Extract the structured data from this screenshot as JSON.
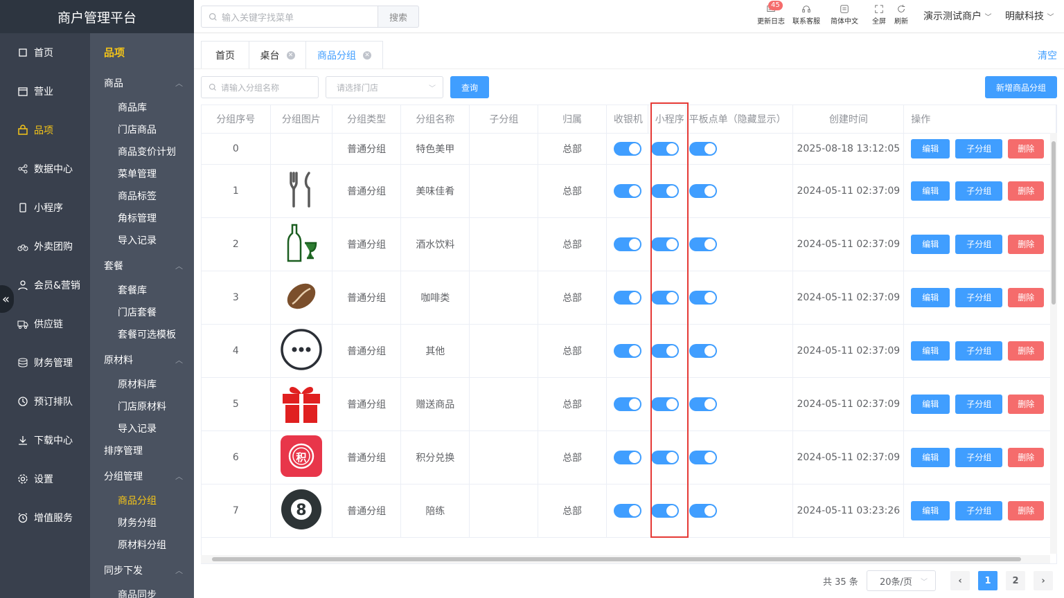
{
  "brand": "商户管理平台",
  "nav": [
    {
      "label": "首页",
      "icon": "home-icon"
    },
    {
      "label": "营业",
      "icon": "calendar-icon"
    },
    {
      "label": "品项",
      "icon": "bag-icon",
      "active": true
    },
    {
      "label": "数据中心",
      "icon": "share-icon"
    },
    {
      "label": "小程序",
      "icon": "phone-icon"
    },
    {
      "label": "外卖团购",
      "icon": "bike-icon"
    },
    {
      "label": "会员&营销",
      "icon": "user-icon"
    },
    {
      "label": "供应链",
      "icon": "truck-icon"
    },
    {
      "label": "财务管理",
      "icon": "database-icon"
    },
    {
      "label": "预订排队",
      "icon": "clock-icon"
    },
    {
      "label": "下载中心",
      "icon": "download-icon"
    },
    {
      "label": "设置",
      "icon": "gear-icon"
    },
    {
      "label": "增值服务",
      "icon": "alarm-icon"
    }
  ],
  "subnav": {
    "title": "品项",
    "groups": [
      {
        "label": "商品",
        "items": [
          "商品库",
          "门店商品",
          "商品变价计划",
          "菜单管理",
          "商品标签",
          "角标管理",
          "导入记录"
        ]
      },
      {
        "label": "套餐",
        "items": [
          "套餐库",
          "门店套餐",
          "套餐可选模板"
        ]
      },
      {
        "label": "原材料",
        "items": [
          "原材料库",
          "门店原材料",
          "导入记录"
        ]
      },
      {
        "label": "排序管理",
        "items": []
      },
      {
        "label": "分组管理",
        "items": [
          "商品分组",
          "财务分组",
          "原材料分组"
        ]
      },
      {
        "label": "同步下发",
        "items": [
          "商品同步"
        ]
      }
    ],
    "active_item": "商品分组"
  },
  "topbar": {
    "search_placeholder": "输入关键字找菜单",
    "search_btn": "搜索",
    "tools": [
      {
        "label": "更新日志",
        "icon": "message-icon",
        "badge": "45"
      },
      {
        "label": "联系客服",
        "icon": "headset-icon"
      },
      {
        "label": "简体中文",
        "icon": "translate-icon"
      },
      {
        "label": "全屏",
        "icon": "fullscreen-icon"
      },
      {
        "label": "刷新",
        "icon": "refresh-icon"
      }
    ],
    "merchant": "演示测试商户",
    "company": "明献科技"
  },
  "tabs": [
    {
      "label": "首页",
      "closable": false,
      "active": false
    },
    {
      "label": "桌台",
      "closable": true,
      "active": false
    },
    {
      "label": "商品分组",
      "closable": true,
      "active": true
    }
  ],
  "clear_label": "清空",
  "filters": {
    "name_placeholder": "请输入分组名称",
    "store_placeholder": "请选择门店",
    "query_btn": "查询",
    "add_btn": "新增商品分组"
  },
  "table": {
    "columns": [
      "分组序号",
      "分组图片",
      "分组类型",
      "分组名称",
      "子分组",
      "归属",
      "收银机",
      "小程序",
      "平板点单（隐藏显示）",
      "创建时间",
      "操作"
    ],
    "actions": {
      "edit": "编辑",
      "sub": "子分组",
      "del": "删除"
    },
    "rows": [
      {
        "seq": "0",
        "image": "",
        "type": "普通分组",
        "name": "特色美甲",
        "sub": "",
        "owner": "总部",
        "pos": true,
        "mini": true,
        "tablet": true,
        "created": "2025-08-18 13:12:05"
      },
      {
        "seq": "1",
        "image": "cutlery-icon",
        "type": "普通分组",
        "name": "美味佳肴",
        "sub": "",
        "owner": "总部",
        "pos": true,
        "mini": true,
        "tablet": true,
        "created": "2024-05-11 02:37:09"
      },
      {
        "seq": "2",
        "image": "wine-icon",
        "type": "普通分组",
        "name": "酒水饮料",
        "sub": "",
        "owner": "总部",
        "pos": true,
        "mini": true,
        "tablet": true,
        "created": "2024-05-11 02:37:09"
      },
      {
        "seq": "3",
        "image": "coffee-bean-icon",
        "type": "普通分组",
        "name": "咖啡类",
        "sub": "",
        "owner": "总部",
        "pos": true,
        "mini": true,
        "tablet": true,
        "created": "2024-05-11 02:37:09"
      },
      {
        "seq": "4",
        "image": "more-icon",
        "type": "普通分组",
        "name": "其他",
        "sub": "",
        "owner": "总部",
        "pos": true,
        "mini": true,
        "tablet": true,
        "created": "2024-05-11 02:37:09"
      },
      {
        "seq": "5",
        "image": "gift-icon",
        "type": "普通分组",
        "name": "赠送商品",
        "sub": "",
        "owner": "总部",
        "pos": true,
        "mini": true,
        "tablet": true,
        "created": "2024-05-11 02:37:09"
      },
      {
        "seq": "6",
        "image": "points-icon",
        "image_text": "积",
        "type": "普通分组",
        "name": "积分兑换",
        "sub": "",
        "owner": "总部",
        "pos": true,
        "mini": true,
        "tablet": true,
        "created": "2024-05-11 02:37:09"
      },
      {
        "seq": "7",
        "image": "billiard-ball-icon",
        "image_text": "8",
        "type": "普通分组",
        "name": "陪练",
        "sub": "",
        "owner": "总部",
        "pos": true,
        "mini": true,
        "tablet": true,
        "created": "2024-05-11 03:23:26"
      }
    ]
  },
  "pagination": {
    "total": "共 35 条",
    "page_size": "20条/页",
    "pages": [
      "1",
      "2"
    ],
    "current": "1"
  },
  "colors": {
    "primary": "#409eff",
    "danger": "#f56c6c",
    "sidebar": "#39404d",
    "highlight_box": "#e53935"
  }
}
